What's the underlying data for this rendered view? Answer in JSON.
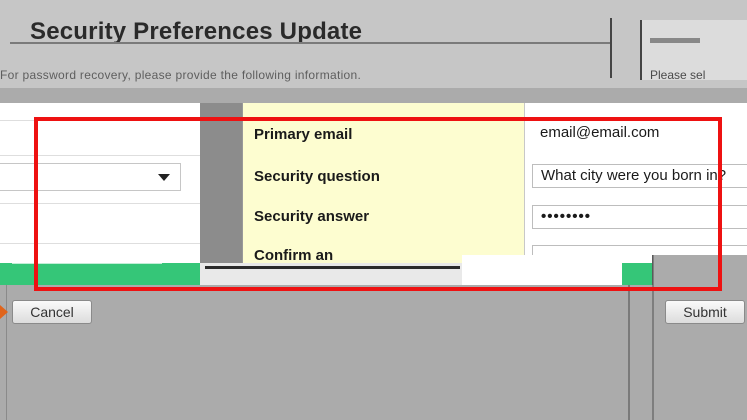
{
  "header": {
    "title": "Security Preferences Update",
    "description": "For password recovery, please provide the following information.",
    "right_stub_text": "Please sel"
  },
  "form": {
    "fields": [
      {
        "label": "Primary email",
        "value": "email@email.com"
      },
      {
        "label": "Security question",
        "value": "What city were you born in?"
      },
      {
        "label": "Security answer",
        "value": "••••••••"
      },
      {
        "label": "Confirm an",
        "value": ""
      }
    ]
  },
  "buttons": {
    "cancel": "Cancel",
    "submit": "Submit"
  },
  "colors": {
    "highlight": "#ee1111",
    "label_column": "#fdfdd0",
    "status_strip": "#35c678",
    "pointer": "#e0641b"
  }
}
